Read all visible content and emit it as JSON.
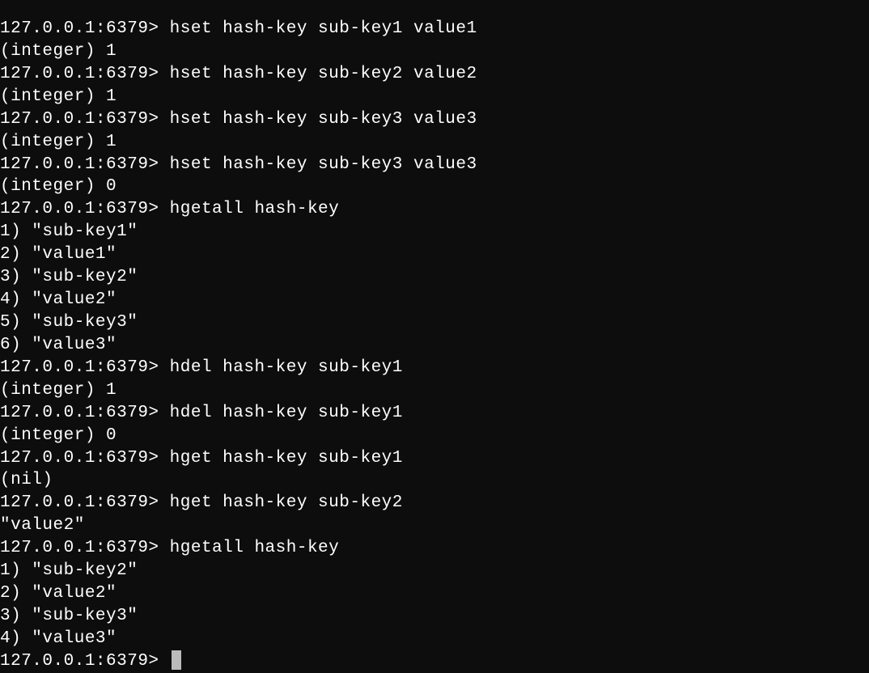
{
  "terminal": {
    "prompt": "127.0.0.1:6379>",
    "lines": [
      {
        "type": "cmd",
        "prompt": "127.0.0.1:6379>",
        "command": "hset hash-key sub-key1 value1"
      },
      {
        "type": "out",
        "text": "(integer) 1"
      },
      {
        "type": "cmd",
        "prompt": "127.0.0.1:6379>",
        "command": "hset hash-key sub-key2 value2"
      },
      {
        "type": "out",
        "text": "(integer) 1"
      },
      {
        "type": "cmd",
        "prompt": "127.0.0.1:6379>",
        "command": "hset hash-key sub-key3 value3"
      },
      {
        "type": "out",
        "text": "(integer) 1"
      },
      {
        "type": "cmd",
        "prompt": "127.0.0.1:6379>",
        "command": "hset hash-key sub-key3 value3"
      },
      {
        "type": "out",
        "text": "(integer) 0"
      },
      {
        "type": "cmd",
        "prompt": "127.0.0.1:6379>",
        "command": "hgetall hash-key"
      },
      {
        "type": "out",
        "text": "1) \"sub-key1\""
      },
      {
        "type": "out",
        "text": "2) \"value1\""
      },
      {
        "type": "out",
        "text": "3) \"sub-key2\""
      },
      {
        "type": "out",
        "text": "4) \"value2\""
      },
      {
        "type": "out",
        "text": "5) \"sub-key3\""
      },
      {
        "type": "out",
        "text": "6) \"value3\""
      },
      {
        "type": "cmd",
        "prompt": "127.0.0.1:6379>",
        "command": "hdel hash-key sub-key1"
      },
      {
        "type": "out",
        "text": "(integer) 1"
      },
      {
        "type": "cmd",
        "prompt": "127.0.0.1:6379>",
        "command": "hdel hash-key sub-key1"
      },
      {
        "type": "out",
        "text": "(integer) 0"
      },
      {
        "type": "cmd",
        "prompt": "127.0.0.1:6379>",
        "command": "hget hash-key sub-key1"
      },
      {
        "type": "out",
        "text": "(nil)"
      },
      {
        "type": "cmd",
        "prompt": "127.0.0.1:6379>",
        "command": "hget hash-key sub-key2"
      },
      {
        "type": "out",
        "text": "\"value2\""
      },
      {
        "type": "cmd",
        "prompt": "127.0.0.1:6379>",
        "command": "hgetall hash-key"
      },
      {
        "type": "out",
        "text": "1) \"sub-key2\""
      },
      {
        "type": "out",
        "text": "2) \"value2\""
      },
      {
        "type": "out",
        "text": "3) \"sub-key3\""
      },
      {
        "type": "out",
        "text": "4) \"value3\""
      },
      {
        "type": "cmd",
        "prompt": "127.0.0.1:6379>",
        "command": "",
        "cursor": true
      }
    ]
  }
}
